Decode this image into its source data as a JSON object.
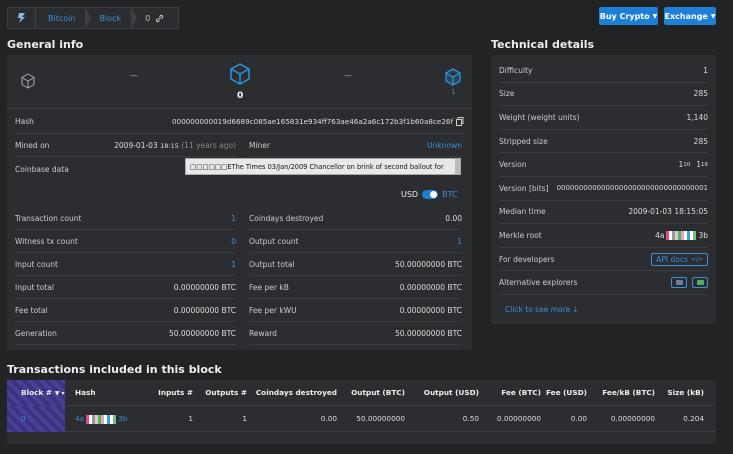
{
  "breadcrumb": {
    "items": [
      "Bitcoin",
      "Block"
    ],
    "current": "0"
  },
  "buttons": {
    "buy": "Buy Crypto",
    "exchange": "Exchange"
  },
  "general": {
    "title": "General info",
    "nav_dash_left": "—",
    "nav_dash_right": "—",
    "height": "0",
    "next_count": "1",
    "hash_label": "Hash",
    "hash_value": "000000000019d6689c085ae165831e934ff763ae46a2a6c172b3f1b60a8ce26f",
    "mined_label": "Mined on",
    "mined_date": "2009-01-03",
    "mined_time": "18:15",
    "mined_ago": "(11 years ago)",
    "miner_label": "Miner",
    "miner_value": "Unknown",
    "coinbase_label": "Coinbase data",
    "coinbase_value": "□□□□□□EThe Times 03/Jan/2009 Chancellor on brink of second bailout for",
    "toggle_left": "USD",
    "toggle_right": "BTC",
    "left_rows": [
      {
        "label": "Transaction count",
        "value": "1"
      },
      {
        "label": "Witness tx count",
        "value": "0"
      },
      {
        "label": "Input count",
        "value": "1"
      },
      {
        "label": "Input total",
        "value": "0.00000000 BTC"
      },
      {
        "label": "Fee total",
        "value": "0.00000000 BTC"
      },
      {
        "label": "Generation",
        "value": "50.00000000 BTC"
      }
    ],
    "right_rows": [
      {
        "label": "Coindays destroyed",
        "value": "0.00"
      },
      {
        "label": "Output count",
        "value": "1"
      },
      {
        "label": "Output total",
        "value": "50.00000000 BTC"
      },
      {
        "label": "Fee per kB",
        "value": "0.00000000 BTC"
      },
      {
        "label": "Fee per kWU",
        "value": "0.00000000 BTC"
      },
      {
        "label": "Reward",
        "value": "50.00000000 BTC"
      }
    ]
  },
  "technical": {
    "title": "Technical details",
    "rows": [
      {
        "label": "Difficulty",
        "value": "1"
      },
      {
        "label": "Size",
        "value": "285"
      },
      {
        "label": "Weight (weight units)",
        "value": "1,140"
      },
      {
        "label": "Stripped size",
        "value": "285"
      },
      {
        "label": "Version",
        "value_a": "1",
        "sub_a": "10",
        "value_b": "1",
        "sub_b": "16"
      },
      {
        "label": "Version [bits]",
        "value": "0000000000000000000000000000000001"
      },
      {
        "label": "Median time",
        "value": "2009-01-03 18:15:05"
      },
      {
        "label": "Merkle root",
        "value_start": "4a",
        "value_end": "3b"
      },
      {
        "label": "For developers",
        "value": "API docs"
      },
      {
        "label": "Alternative explorers",
        "value": ""
      }
    ],
    "more_link": "Click to see more"
  },
  "transactions": {
    "title": "Transactions included in this block",
    "headers": [
      "Block #",
      "Hash",
      "Inputs #",
      "Outputs #",
      "Coindays destroyed",
      "Output (BTC)",
      "Output (USD)",
      "Fee (BTC)",
      "Fee (USD)",
      "Fee/kB (BTC)",
      "Size (kB)"
    ],
    "row": {
      "block": "0",
      "hash_start": "4a",
      "hash_end": "3b",
      "inputs": "1",
      "outputs": "1",
      "coindays": "0.00",
      "output_btc": "50.00000000",
      "output_usd": "0.50",
      "fee_btc": "0.00000000",
      "fee_usd": "0.00",
      "fee_kb": "0.00000000",
      "size": "0.204"
    }
  },
  "colors": {
    "accent": "#1e7fd8",
    "link": "#3d8fd6",
    "panel": "#2c2d30",
    "bg": "#222325"
  }
}
